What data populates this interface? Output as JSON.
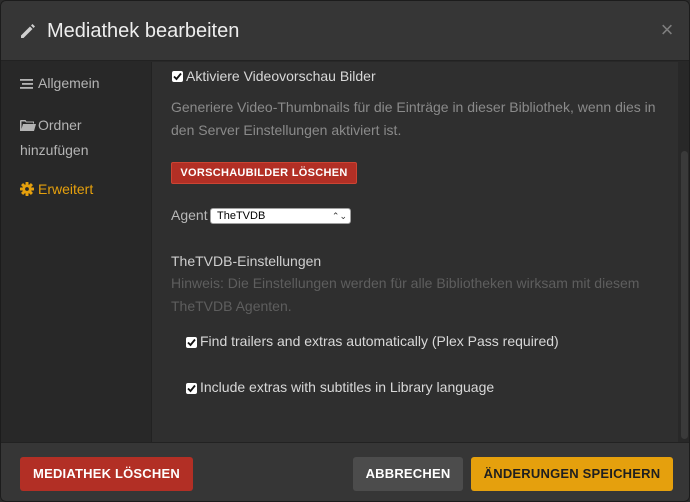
{
  "dialog": {
    "title": "Mediathek bearbeiten",
    "close_glyph": "×"
  },
  "sidebar": {
    "items": [
      {
        "label": "Allgemein",
        "icon": "list-icon",
        "active": false
      },
      {
        "label": "Ordner hinzufügen",
        "icon": "folder-icon",
        "active": false
      },
      {
        "label": "Erweitert",
        "icon": "gear-icon",
        "active": true
      }
    ]
  },
  "main": {
    "video_preview": {
      "label": "Aktiviere Videovorschau Bilder",
      "checked": true,
      "help": "Generiere Video-Thumbnails für die Einträge in dieser Bibliothek, wenn dies in den Server Einstellungen aktiviert ist."
    },
    "clear_thumbs_button": "VORSCHAUBILDER LÖSCHEN",
    "agent": {
      "label": "Agent",
      "selected": "TheTVDB",
      "arrows": "⌃⌄"
    },
    "agent_settings": {
      "heading": "TheTVDB-Einstellungen",
      "hint": "Hinweis: Die Einstellungen werden für alle Bibliotheken wirksam mit diesem TheTVDB Agenten.",
      "options": [
        {
          "label": "Find trailers and extras automatically (Plex Pass required)",
          "checked": true
        },
        {
          "label": "Include extras with subtitles in Library language",
          "checked": true
        }
      ]
    }
  },
  "footer": {
    "delete_label": "MEDIATHEK LÖSCHEN",
    "cancel_label": "ABBRECHEN",
    "save_label": "ÄNDERUNGEN SPEICHERN"
  },
  "colors": {
    "accent": "#e5a00d",
    "danger": "#b22f25",
    "background": "#282828",
    "panel": "#2f2f2f"
  }
}
